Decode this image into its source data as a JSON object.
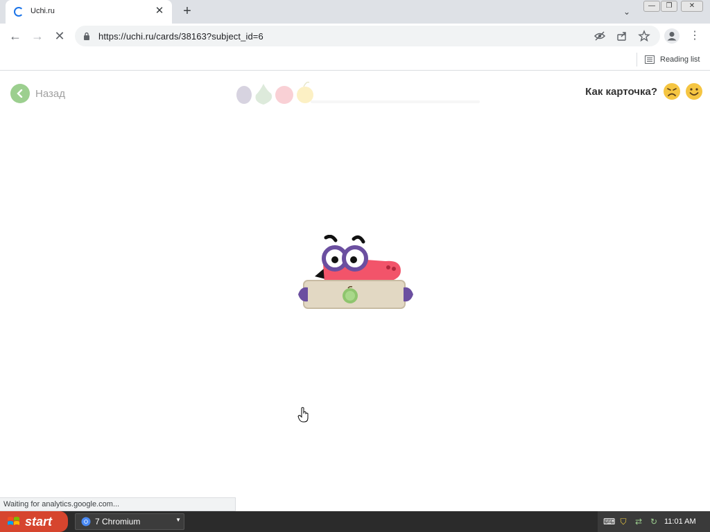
{
  "browser": {
    "tab": {
      "title": "Uchi.ru",
      "close_glyph": "✕"
    },
    "new_tab_glyph": "+",
    "tab_search_glyph": "⌄",
    "window_buttons": {
      "minimize": "—",
      "restore": "❐",
      "close": "✕"
    },
    "nav": {
      "back_glyph": "←",
      "forward_glyph": "→",
      "stop_glyph": "✕"
    },
    "url": "https://uchi.ru/cards/38163?subject_id=6",
    "omnibox_icons": [
      "eye-off-icon",
      "share-icon",
      "star-icon"
    ],
    "menu_glyph": "⋮",
    "reading_list": "Reading list"
  },
  "page": {
    "back_label": "Назад",
    "rate_label": "Как карточка?",
    "fruits": [
      "plum-icon",
      "pear-icon",
      "apple-icon",
      "lemon-icon"
    ],
    "reactions": [
      "sad-face-icon",
      "happy-face-icon"
    ],
    "mascot": "worm-mascot-with-apple-sign",
    "colors": {
      "back_green": "#9ccf8f",
      "mascot_pink": "#f2546a",
      "mascot_purple": "#6b4fa0",
      "sign_beige": "#e2d8c3",
      "reaction_yellow": "#f5c542"
    }
  },
  "status": {
    "text": "Waiting for analytics.google.com..."
  },
  "taskbar": {
    "start_label": "start",
    "task_label": "7 Chromium",
    "clock": "11:01 AM"
  }
}
